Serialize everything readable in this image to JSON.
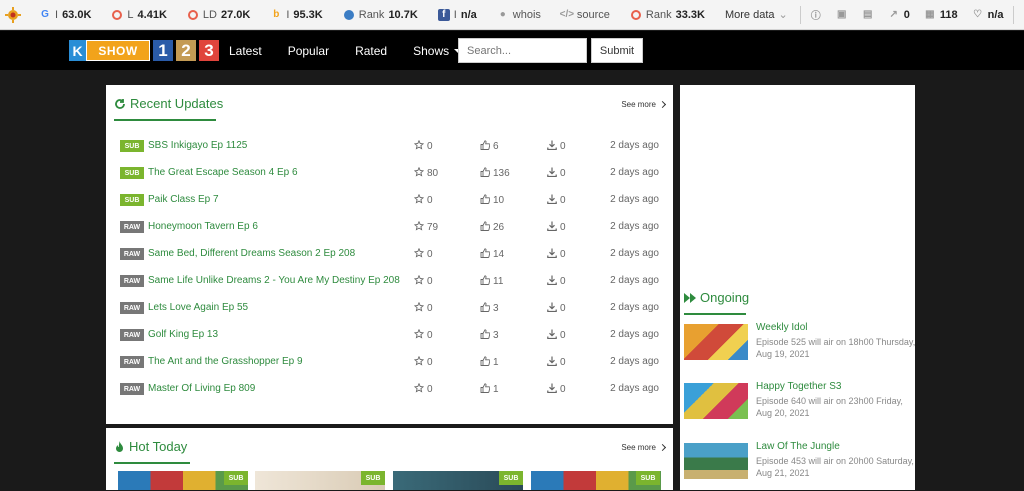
{
  "seobar": {
    "items": [
      {
        "prefix": "I",
        "value": "63.0K"
      },
      {
        "prefix": "L",
        "value": "4.41K"
      },
      {
        "prefix": "LD",
        "value": "27.0K"
      },
      {
        "prefix": "I",
        "value": "95.3K"
      },
      {
        "prefix": "Rank",
        "value": "10.7K"
      },
      {
        "prefix": "I",
        "value": "n/a"
      },
      {
        "prefix": "whois",
        "value": ""
      },
      {
        "prefix": "source",
        "value": ""
      },
      {
        "prefix": "Rank",
        "value": "33.3K"
      }
    ],
    "more": "More data",
    "right": {
      "links": "0",
      "pages": "118",
      "social": "n/a"
    }
  },
  "nav": {
    "brand": {
      "k": "K",
      "show": "SHOW",
      "n1": "1",
      "n2": "2",
      "n3": "3"
    },
    "links": [
      "Latest",
      "Popular",
      "Rated",
      "Shows"
    ],
    "search_placeholder": "Search...",
    "submit": "Submit"
  },
  "recent": {
    "title": "Recent Updates",
    "see_more": "See more",
    "rows": [
      {
        "badge": "SUB",
        "title": "SBS Inkigayo Ep 1125",
        "stars": "0",
        "likes": "6",
        "downloads": "0",
        "date": "2 days ago"
      },
      {
        "badge": "SUB",
        "title": "The Great Escape Season 4 Ep 6",
        "stars": "80",
        "likes": "136",
        "downloads": "0",
        "date": "2 days ago"
      },
      {
        "badge": "SUB",
        "title": "Paik Class Ep 7",
        "stars": "0",
        "likes": "10",
        "downloads": "0",
        "date": "2 days ago"
      },
      {
        "badge": "RAW",
        "title": "Honeymoon Tavern Ep 6",
        "stars": "79",
        "likes": "26",
        "downloads": "0",
        "date": "2 days ago"
      },
      {
        "badge": "RAW",
        "title": "Same Bed, Different Dreams Season 2 Ep 208",
        "stars": "0",
        "likes": "14",
        "downloads": "0",
        "date": "2 days ago"
      },
      {
        "badge": "RAW",
        "title": "Same Life Unlike Dreams 2 - You Are My Destiny Ep 208",
        "stars": "0",
        "likes": "11",
        "downloads": "0",
        "date": "2 days ago"
      },
      {
        "badge": "RAW",
        "title": "Lets Love Again Ep 55",
        "stars": "0",
        "likes": "3",
        "downloads": "0",
        "date": "2 days ago"
      },
      {
        "badge": "RAW",
        "title": "Golf King Ep 13",
        "stars": "0",
        "likes": "3",
        "downloads": "0",
        "date": "2 days ago"
      },
      {
        "badge": "RAW",
        "title": "The Ant and the Grasshopper Ep 9",
        "stars": "0",
        "likes": "1",
        "downloads": "0",
        "date": "2 days ago"
      },
      {
        "badge": "RAW",
        "title": "Master Of Living Ep 809",
        "stars": "0",
        "likes": "1",
        "downloads": "0",
        "date": "2 days ago"
      }
    ]
  },
  "hot": {
    "title": "Hot Today",
    "see_more": "See more",
    "badges": [
      "SUB",
      "SUB",
      "SUB",
      "SUB"
    ]
  },
  "ongoing": {
    "title": "Ongoing",
    "items": [
      {
        "name": "Weekly Idol",
        "desc": "Episode 525 will air on 18h00 Thursday, Aug 19, 2021"
      },
      {
        "name": "Happy Together S3",
        "desc": "Episode 640 will air on 23h00 Friday, Aug 20, 2021"
      },
      {
        "name": "Law Of The Jungle",
        "desc": "Episode 453 will air on 20h00 Saturday, Aug 21, 2021"
      }
    ]
  },
  "colors": {
    "accent": "#2e8b3e",
    "sub": "#7bb52e",
    "raw": "#777777"
  }
}
